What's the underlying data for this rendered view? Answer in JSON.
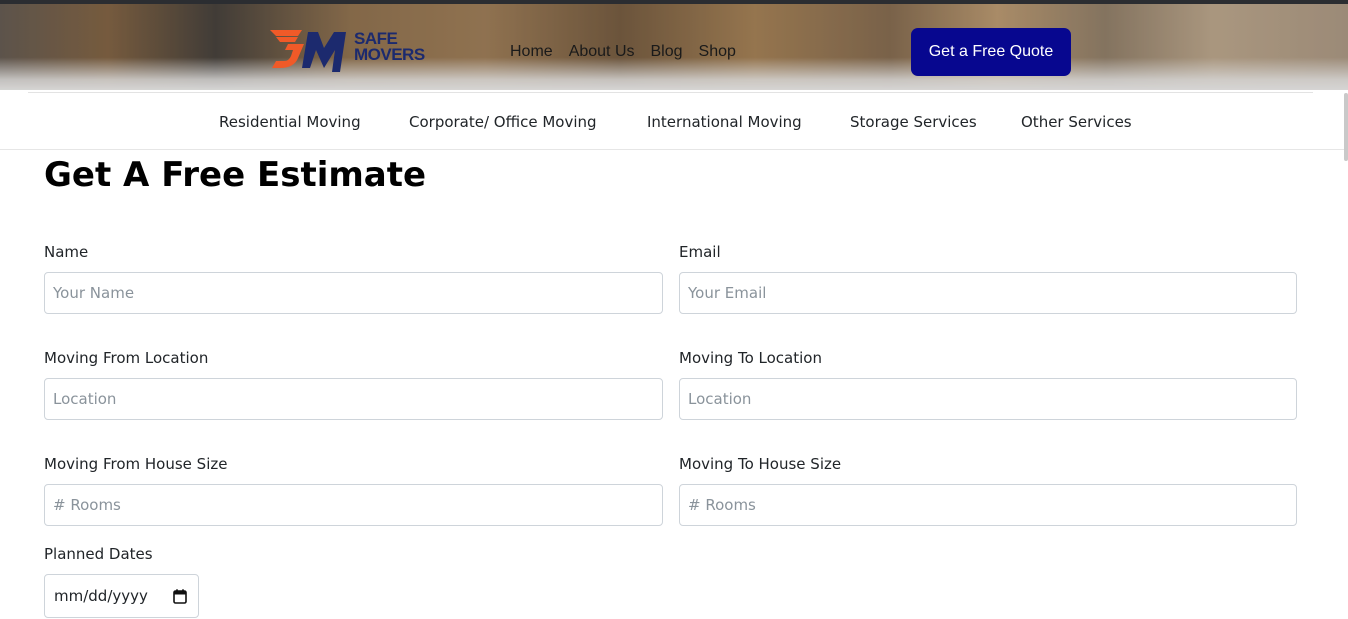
{
  "brand": {
    "line1": "SAFE",
    "line2": "MOVERS",
    "accent": "#f05a28",
    "navy": "#1c2a6e"
  },
  "main_nav": [
    {
      "label": "Home"
    },
    {
      "label": "About Us"
    },
    {
      "label": "Blog"
    },
    {
      "label": "Shop"
    }
  ],
  "cta": {
    "label": "Get a Free Quote",
    "color": "#07078f"
  },
  "services_nav": [
    {
      "label": "Residential Moving"
    },
    {
      "label": "Corporate/ Office Moving"
    },
    {
      "label": "International Moving"
    },
    {
      "label": "Storage Services"
    },
    {
      "label": "Other Services"
    }
  ],
  "form": {
    "title": "Get A Free Estimate",
    "name": {
      "label": "Name",
      "placeholder": "Your Name"
    },
    "email": {
      "label": "Email",
      "placeholder": "Your Email"
    },
    "from_location": {
      "label": "Moving From Location",
      "placeholder": "Location"
    },
    "to_location": {
      "label": "Moving To Location",
      "placeholder": "Location"
    },
    "from_size": {
      "label": "Moving From House Size",
      "placeholder": "# Rooms"
    },
    "to_size": {
      "label": "Moving To House Size",
      "placeholder": "# Rooms"
    },
    "dates": {
      "label": "Planned Dates",
      "value": "mm/dd/yyyy",
      "icon": "calendar-icon"
    }
  }
}
